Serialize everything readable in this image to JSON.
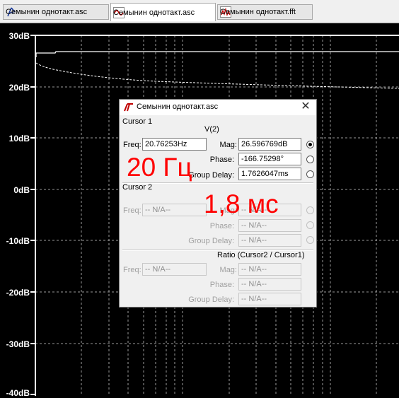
{
  "tabs": [
    {
      "label": "Семынин однотакт.asc",
      "icon": "schematic-icon",
      "active": false
    },
    {
      "label": "Семынин однотакт.asc",
      "icon": "waveform-icon",
      "active": true
    },
    {
      "label": "Семынин однотакт.fft",
      "icon": "fft-icon",
      "active": false
    }
  ],
  "plot": {
    "y_ticks": [
      "30dB",
      "20dB",
      "10dB",
      "0dB",
      "-10dB",
      "-20dB",
      "-30dB",
      "-40dB"
    ],
    "background": "#000000",
    "trace_color": "#ffffff"
  },
  "dialog": {
    "title": "Семынин однотакт.asc",
    "cursor1": {
      "group": "Cursor 1",
      "trace": "V(2)",
      "freq_label": "Freq:",
      "freq": "20.76253Hz",
      "mag_label": "Mag:",
      "mag": "26.596769dB",
      "phase_label": "Phase:",
      "phase": "-166.75298°",
      "delay_label": "Group Delay:",
      "delay": "1.7626047ms"
    },
    "cursor2": {
      "group": "Cursor 2",
      "freq_label": "Freq:",
      "freq": "-- N/A--",
      "mag_label": "Mag:",
      "mag": "-- N/A--",
      "phase_label": "Phase:",
      "phase": "-- N/A--",
      "delay_label": "Group Delay:",
      "delay": "-- N/A--"
    },
    "ratio": {
      "group": "Ratio (Cursor2 / Cursor1)",
      "freq_label": "Freq:",
      "freq": "-- N/A--",
      "mag_label": "Mag:",
      "mag": "-- N/A--",
      "phase_label": "Phase:",
      "phase": "-- N/A--",
      "delay_label": "Group Delay:",
      "delay": "-- N/A--"
    }
  },
  "annotations": {
    "freq_note": "20 Гц",
    "delay_note": "1,8 мс",
    "color": "#ff0000"
  }
}
